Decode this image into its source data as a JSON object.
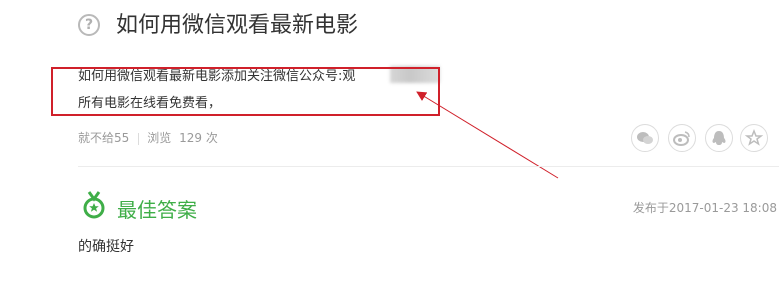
{
  "question": {
    "icon": "question-circle-icon",
    "title": "如何用微信观看最新电影",
    "body_line1": "如何用微信观看最新电影添加关注微信公众号:观",
    "body_line2": "所有电影在线看免费看，"
  },
  "meta": {
    "no_give": "就不给55",
    "views_label": "浏览",
    "views_count": "129",
    "views_unit": "次"
  },
  "share_icons": [
    "wechat-icon",
    "weibo-icon",
    "qq-icon",
    "star-icon"
  ],
  "best_answer": {
    "title": "最佳答案",
    "date": "发布于2017-01-23 18:08",
    "text": "的确挺好"
  },
  "colors": {
    "accent_green": "#3fae48",
    "annotation_red": "#d0202a",
    "text": "#333333",
    "muted": "#9a9a9a"
  }
}
